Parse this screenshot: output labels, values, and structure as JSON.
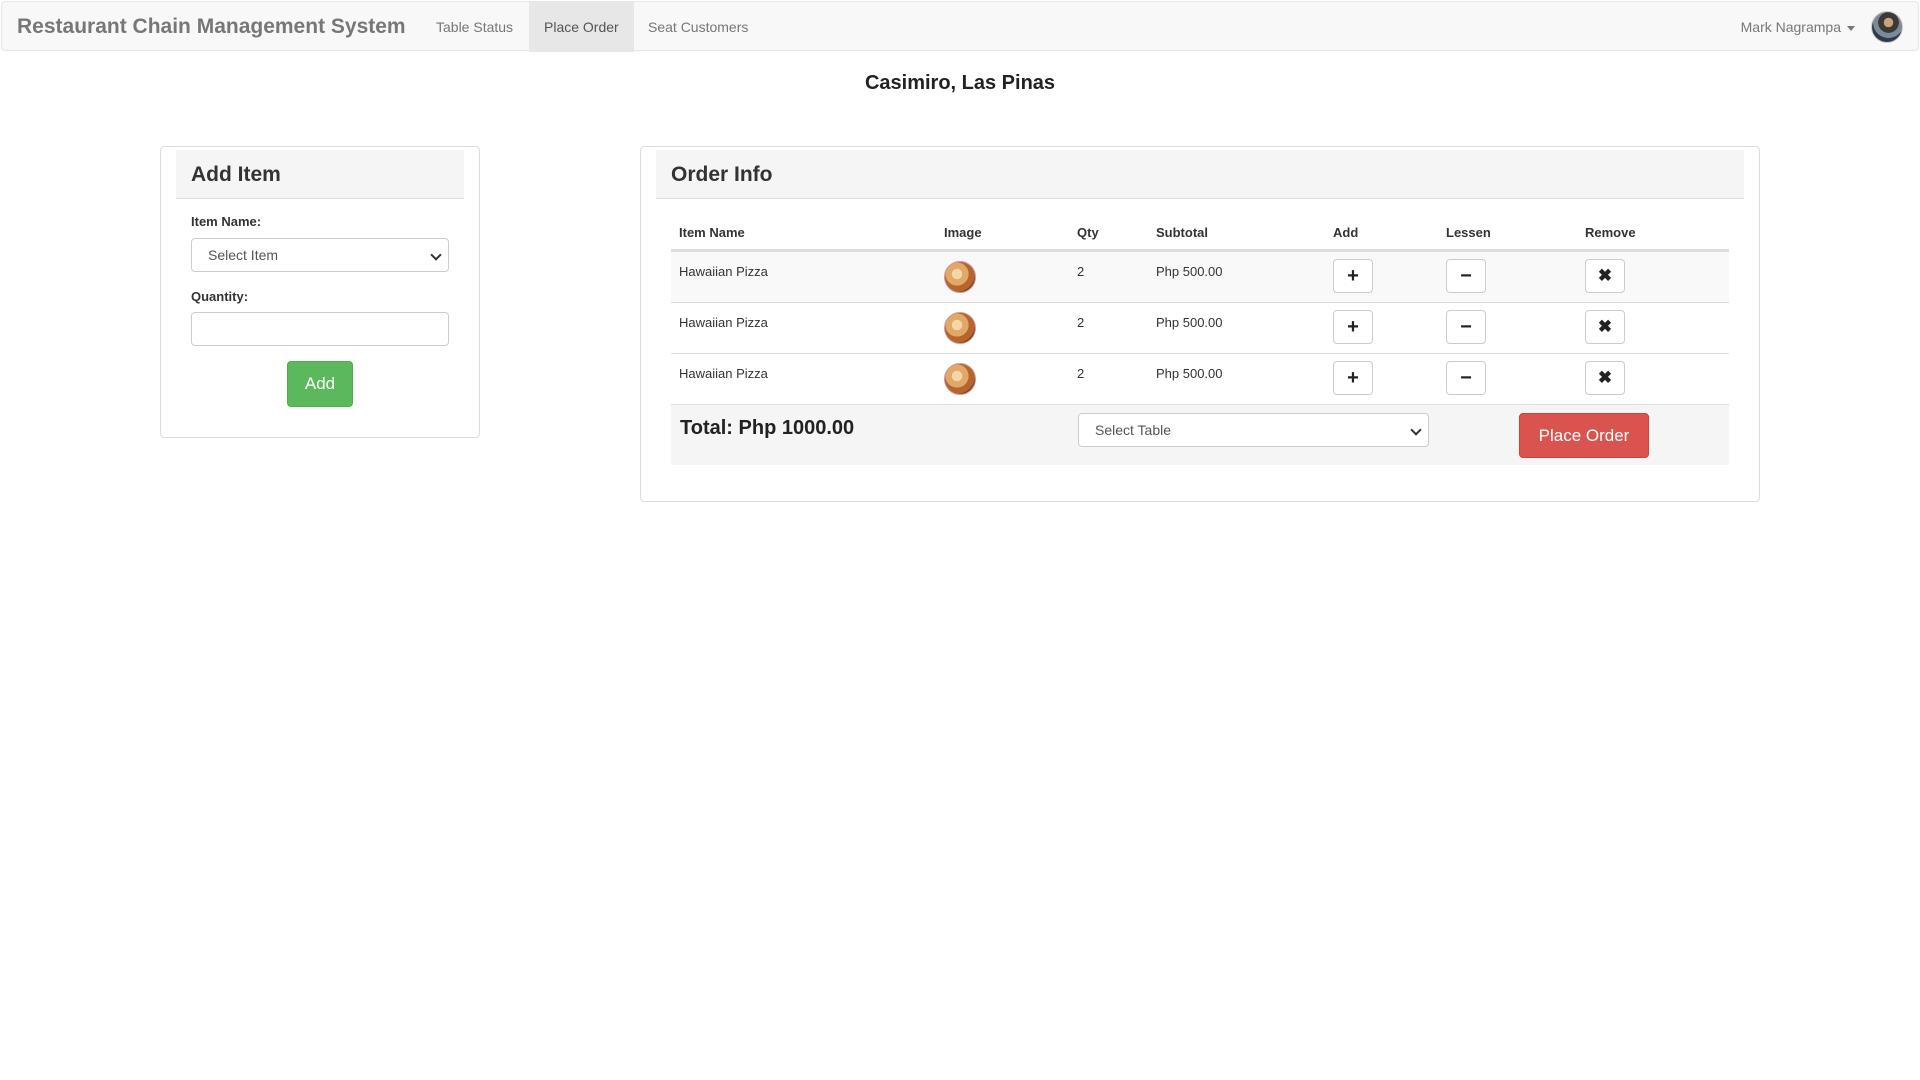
{
  "navbar": {
    "brand": "Restaurant Chain Management System",
    "items": [
      {
        "label": "Table Status",
        "active": false
      },
      {
        "label": "Place Order",
        "active": true
      },
      {
        "label": "Seat Customers",
        "active": false
      }
    ],
    "user_name": "Mark Nagrampa"
  },
  "branch_title": "Casimiro, Las Pinas",
  "add_item": {
    "heading": "Add Item",
    "item_name_label": "Item Name:",
    "item_select_value": "Select Item",
    "quantity_label": "Quantity:",
    "quantity_value": "",
    "add_button": "Add"
  },
  "order_info": {
    "heading": "Order Info",
    "columns": [
      "Item Name",
      "Image",
      "Qty",
      "Subtotal",
      "Add",
      "Lessen",
      "Remove"
    ],
    "rows": [
      {
        "name": "Hawaiian Pizza",
        "qty": "2",
        "subtotal": "Php 500.00"
      },
      {
        "name": "Hawaiian Pizza",
        "qty": "2",
        "subtotal": "Php 500.00"
      },
      {
        "name": "Hawaiian Pizza",
        "qty": "2",
        "subtotal": "Php 500.00"
      }
    ],
    "total": "Total: Php 1000.00",
    "table_select_value": "Select Table",
    "place_order_button": "Place Order",
    "add_icon": "+",
    "lessen_icon": "−",
    "remove_icon": "✖"
  },
  "colors": {
    "success": "#5cb85c",
    "danger": "#d9534f",
    "navbar_bg": "#f8f8f8"
  }
}
